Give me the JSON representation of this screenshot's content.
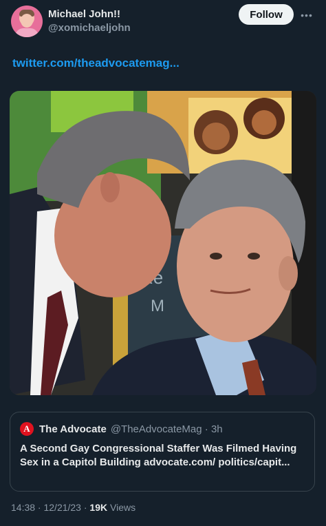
{
  "author": {
    "name": "Michael John!!",
    "handle": "@xomichaeljohn"
  },
  "follow_label": "Follow",
  "more_icon": "more-horizontal-icon",
  "tweet": {
    "link_text": "twitter.com/theadvocatemag..."
  },
  "quoted": {
    "source_logo_letter": "A",
    "source_name": "The Advocate",
    "source_handle_time": "@TheAdvocateMag · 3h",
    "text": "A Second Gay Congressional Staffer Was Filmed Having Sex in a Capitol Building advocate.com/ politics/capit..."
  },
  "meta": {
    "timestamp": "14:38 · 12/21/23 · ",
    "views_count": "19K",
    "views_label": " Views"
  },
  "colors": {
    "background": "#15202b",
    "link": "#1d9bf0",
    "secondary_text": "#8b98a5",
    "advocate_red": "#e0121f"
  }
}
